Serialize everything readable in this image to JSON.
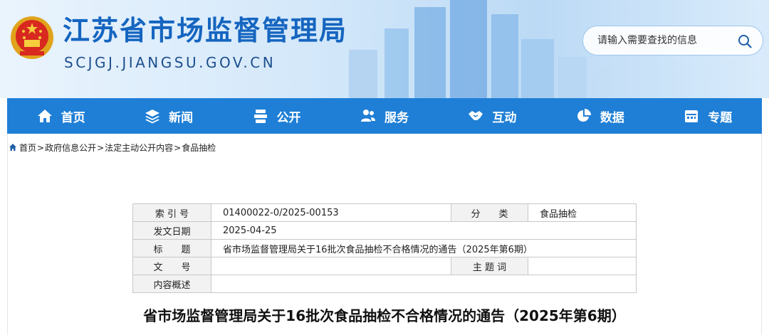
{
  "header": {
    "title": "江苏省市场监督管理局",
    "domain": "SCJGJ.JIANGSU.GOV.CN",
    "search_placeholder": "请输入需要查找的信息"
  },
  "nav": {
    "items": [
      {
        "label": "首页",
        "icon": "home-icon"
      },
      {
        "label": "新闻",
        "icon": "layers-icon"
      },
      {
        "label": "公开",
        "icon": "stack-icon"
      },
      {
        "label": "服务",
        "icon": "users-icon"
      },
      {
        "label": "互动",
        "icon": "handshake-icon"
      },
      {
        "label": "数据",
        "icon": "pie-chart-icon"
      },
      {
        "label": "专题",
        "icon": "calendar-icon"
      }
    ],
    "color": "#1f7fd6"
  },
  "breadcrumb": {
    "items": [
      "首页",
      "政府信息公开",
      "法定主动公开内容",
      "食品抽检"
    ],
    "separator": ">"
  },
  "meta_table": {
    "index_label": "索 引 号",
    "index_value": "01400022-0/2025-00153",
    "category_label": "分　　类",
    "category_value": "食品抽检",
    "date_label": "发文日期",
    "date_value": "2025-04-25",
    "title_label": "标　　题",
    "title_value": "省市场监督管理局关于16批次食品抽检不合格情况的通告（2025年第6期）",
    "docno_label": "文　　号",
    "docno_value": "",
    "keywords_label": "主 题 词",
    "keywords_value": "",
    "summary_label": "内容概述",
    "summary_value": ""
  },
  "article": {
    "title": "省市场监督管理局关于16批次食品抽检不合格情况的通告（2025年第6期）"
  }
}
